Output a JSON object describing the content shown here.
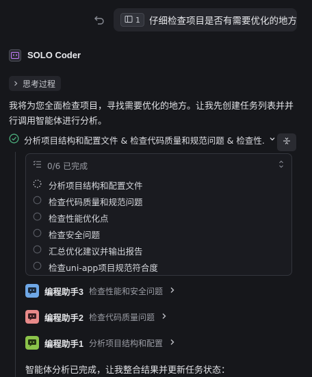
{
  "user_message": {
    "context_chip": {
      "icon": "file-panel-icon",
      "count": "1"
    },
    "text": "仔细检查项目是否有需要优化的地方"
  },
  "agent": {
    "name": "SOLO Coder",
    "icon": "agent-logo-icon"
  },
  "thinking": {
    "label": "思考过程"
  },
  "intro": "我将为您全面检查项目，寻找需要优化的地方。让我先创建任务列表并并行调用智能体进行分析。",
  "task_summary": {
    "text": "分析项目结构和配置文件 & 检查代码质量和规范问题 & 检查性...",
    "status": "done"
  },
  "todo": {
    "progress": "0/6 已完成",
    "items": [
      {
        "label": "分析项目结构和配置文件",
        "state": "in-progress"
      },
      {
        "label": "检查代码质量和规范问题",
        "state": "pending"
      },
      {
        "label": "检查性能优化点",
        "state": "pending"
      },
      {
        "label": "检查安全问题",
        "state": "pending"
      },
      {
        "label": "汇总优化建议并输出报告",
        "state": "pending"
      },
      {
        "label": "检查uni-app项目规范符合度",
        "state": "pending"
      }
    ]
  },
  "helpers": [
    {
      "name": "编程助手3",
      "desc": "检查性能和安全问题",
      "color": "#6ea7e6",
      "icon": "chat-bot-icon"
    },
    {
      "name": "编程助手2",
      "desc": "检查代码质量问题",
      "color": "#e88a8a",
      "icon": "chat-bot-icon"
    },
    {
      "name": "编程助手1",
      "desc": "分析项目结构和配置",
      "color": "#8bc34a",
      "icon": "chat-bot-icon"
    }
  ],
  "final_text": "智能体分析已完成，让我整合结果并更新任务状态：",
  "colors": {
    "background": "#16171b",
    "success": "#4caf7d",
    "muted": "#9a9ca4"
  }
}
